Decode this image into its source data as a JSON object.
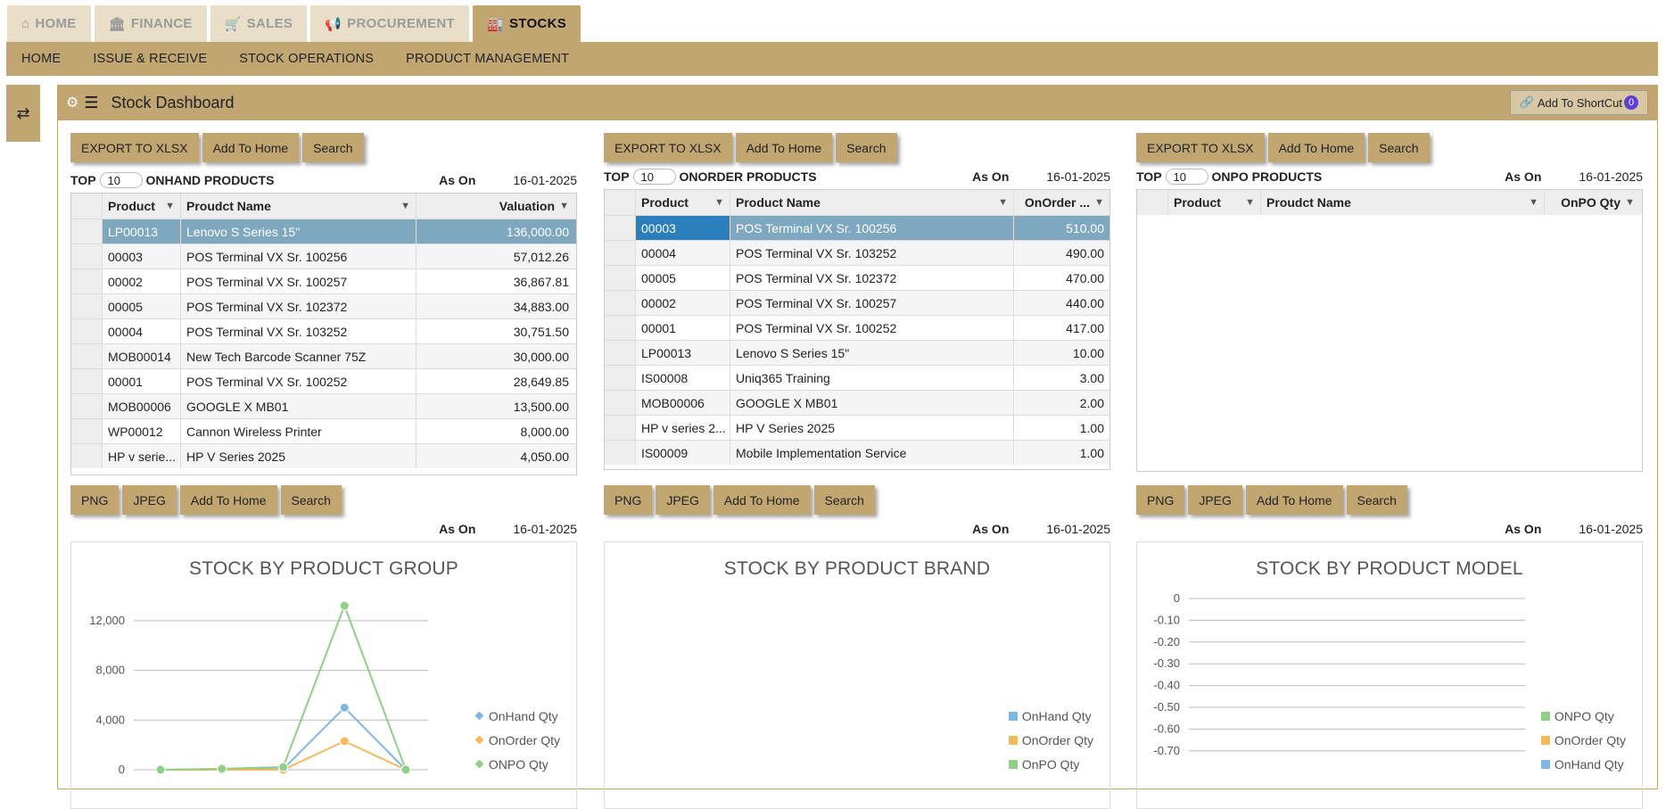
{
  "top_tabs": [
    {
      "icon": "home-icon",
      "glyph": "⌂",
      "label": "HOME"
    },
    {
      "icon": "bank-icon",
      "glyph": "🏛",
      "label": "FINANCE"
    },
    {
      "icon": "cart-icon",
      "glyph": "🛒",
      "label": "SALES"
    },
    {
      "icon": "megaphone-icon",
      "glyph": "📢",
      "label": "PROCUREMENT"
    },
    {
      "icon": "factory-icon",
      "glyph": "🏭",
      "label": "STOCKS"
    }
  ],
  "subnav": [
    "HOME",
    "ISSUE & RECEIVE",
    "STOCK OPERATIONS",
    "PRODUCT MANAGEMENT"
  ],
  "dashboard": {
    "title": "Stock Dashboard",
    "shortcut_label": "Add To ShortCut",
    "shortcut_count": "0"
  },
  "grid_buttons": [
    "EXPORT TO XLSX",
    "Add To Home",
    "Search"
  ],
  "chart_buttons": [
    "PNG",
    "JPEG",
    "Add To Home",
    "Search"
  ],
  "as_on_label": "As On",
  "top_label": "TOP",
  "panels": [
    {
      "title": "ONHAND PRODUCTS",
      "top_value": "10",
      "date": "16-01-2025",
      "columns": [
        "Product",
        "Proudct Name",
        "Valuation"
      ],
      "rows": [
        [
          "LP00013",
          "Lenovo S Series 15\"",
          "136,000.00"
        ],
        [
          "00003",
          "POS Terminal VX Sr. 100256",
          "57,012.26"
        ],
        [
          "00002",
          "POS Terminal VX Sr. 100257",
          "36,867.81"
        ],
        [
          "00005",
          "POS Terminal VX Sr. 102372",
          "34,883.00"
        ],
        [
          "00004",
          "POS Terminal VX Sr. 103252",
          "30,751.50"
        ],
        [
          "MOB00014",
          "New Tech Barcode Scanner 75Z",
          "30,000.00"
        ],
        [
          "00001",
          "POS Terminal VX Sr. 100252",
          "28,649.85"
        ],
        [
          "MOB00006",
          "GOOGLE X MB01",
          "13,500.00"
        ],
        [
          "WP00012",
          "Cannon Wireless Printer",
          "8,000.00"
        ],
        [
          "HP v serie...",
          "HP V Series 2025",
          "4,050.00"
        ]
      ]
    },
    {
      "title": "ONORDER PRODUCTS",
      "top_value": "10",
      "date": "16-01-2025",
      "columns": [
        "Product",
        "Product Name",
        "OnOrder ..."
      ],
      "rows": [
        [
          "00003",
          "POS Terminal VX Sr. 100256",
          "510.00"
        ],
        [
          "00004",
          "POS Terminal VX Sr. 103252",
          "490.00"
        ],
        [
          "00005",
          "POS Terminal VX Sr. 102372",
          "470.00"
        ],
        [
          "00002",
          "POS Terminal VX Sr. 100257",
          "440.00"
        ],
        [
          "00001",
          "POS Terminal VX Sr. 100252",
          "417.00"
        ],
        [
          "LP00013",
          "Lenovo S Series 15\"",
          "10.00"
        ],
        [
          "IS00008",
          "Uniq365 Training",
          "3.00"
        ],
        [
          "MOB00006",
          "GOOGLE X MB01",
          "2.00"
        ],
        [
          "HP v series 2...",
          "HP V Series 2025",
          "1.00"
        ],
        [
          "IS00009",
          "Mobile Implementation Service",
          "1.00"
        ]
      ]
    },
    {
      "title": "ONPO PRODUCTS",
      "top_value": "10",
      "date": "16-01-2025",
      "columns": [
        "Product",
        "Proudct Name",
        "OnPO Qty"
      ],
      "rows": []
    }
  ],
  "charts": [
    {
      "title": "STOCK BY PRODUCT GROUP",
      "date": "16-01-2025",
      "legend": [
        "OnHand Qty",
        "OnOrder Qty",
        "ONPO Qty"
      ]
    },
    {
      "title": "STOCK BY PRODUCT BRAND",
      "date": "16-01-2025",
      "legend": [
        "OnHand Qty",
        "OnOrder Qty",
        "OnPO Qty"
      ]
    },
    {
      "title": "STOCK BY PRODUCT MODEL",
      "date": "16-01-2025",
      "legend": [
        "ONPO Qty",
        "OnOrder Qty",
        "OnHand Qty"
      ]
    }
  ],
  "chart_data": [
    {
      "type": "line",
      "title": "STOCK BY PRODUCT GROUP",
      "yticks": [
        "12,000",
        "8,000",
        "4,000",
        "0"
      ],
      "ylim": [
        0,
        14000
      ],
      "series": [
        {
          "name": "OnHand Qty",
          "color": "#7fb6e3",
          "values": [
            0,
            30,
            60,
            5000,
            0
          ]
        },
        {
          "name": "OnOrder Qty",
          "color": "#f5b85a",
          "values": [
            0,
            0,
            0,
            2300,
            0
          ]
        },
        {
          "name": "ONPO Qty",
          "color": "#8fcf86",
          "values": [
            0,
            80,
            220,
            13200,
            0
          ]
        }
      ]
    },
    {
      "type": "bar",
      "title": "STOCK BY PRODUCT BRAND",
      "series": []
    },
    {
      "type": "line",
      "title": "STOCK BY PRODUCT MODEL",
      "yticks": [
        "0",
        "-0.10",
        "-0.20",
        "-0.30",
        "-0.40",
        "-0.50",
        "-0.60",
        "-0.70"
      ],
      "ylim": [
        -0.7,
        0
      ],
      "series": []
    }
  ],
  "colors": {
    "accent": "#c2a671",
    "selected_row": "#7ea8bf",
    "selected_cell": "#2b7fbd",
    "badge": "#5b3fd6"
  }
}
